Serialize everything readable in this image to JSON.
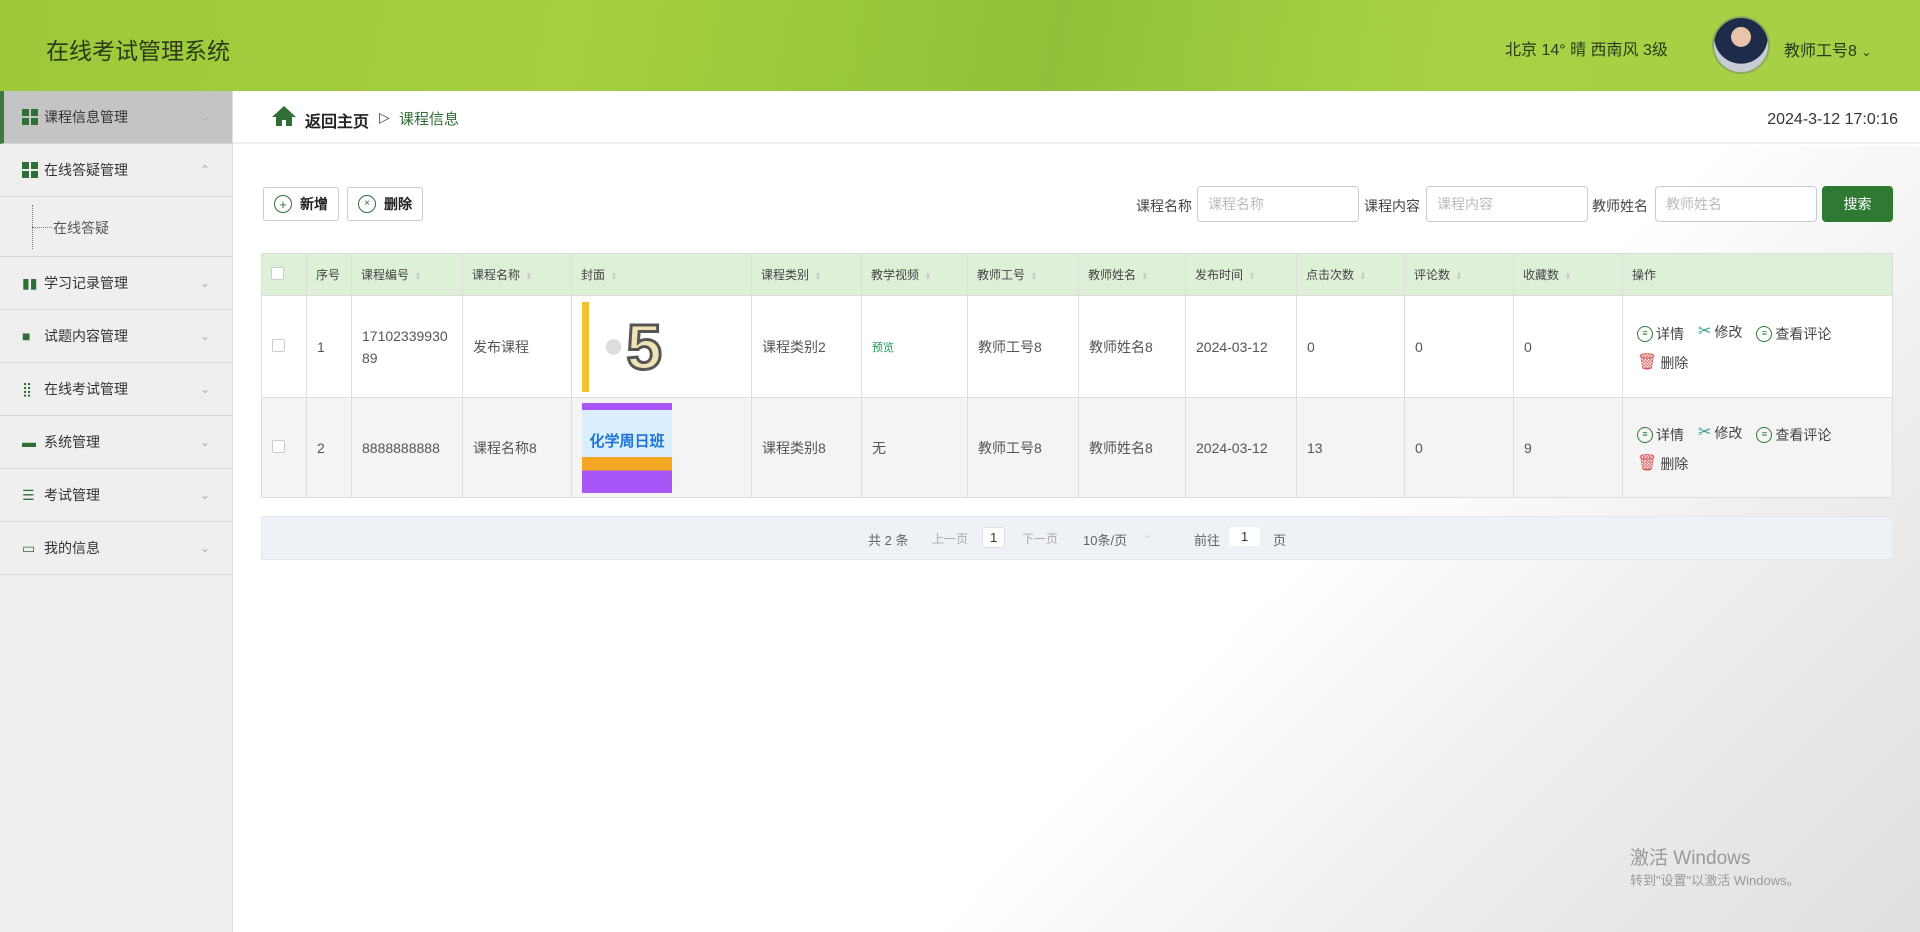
{
  "header": {
    "title": "在线考试管理系统",
    "weather": "北京  14°  晴  西南风  3级",
    "user": "教师工号8",
    "user_caret": "⌄"
  },
  "sidebar": {
    "items": [
      {
        "label": "课程信息管理",
        "chev": "⌄"
      },
      {
        "label": "在线答疑管理",
        "chev": "⌃",
        "sub": [
          "在线答疑"
        ]
      },
      {
        "label": "学习记录管理",
        "chev": "⌄"
      },
      {
        "label": "试题内容管理",
        "chev": "⌄"
      },
      {
        "label": "在线考试管理",
        "chev": "⌄"
      },
      {
        "label": "系统管理",
        "chev": "⌄"
      },
      {
        "label": "考试管理",
        "chev": "⌄"
      },
      {
        "label": "我的信息",
        "chev": "⌄"
      }
    ]
  },
  "breadcrumb": {
    "home": "返回主页",
    "sep": "▷",
    "current": "课程信息",
    "datetime": "2024-3-12 17:0:16"
  },
  "toolbar": {
    "add": "新增",
    "delete": "删除"
  },
  "search": {
    "fields": [
      {
        "label": "课程名称",
        "placeholder": "课程名称"
      },
      {
        "label": "课程内容",
        "placeholder": "课程内容"
      },
      {
        "label": "教师姓名",
        "placeholder": "教师姓名"
      }
    ],
    "button": "搜索"
  },
  "table": {
    "headers": [
      "序号",
      "课程编号",
      "课程名称",
      "封面",
      "课程类别",
      "教学视频",
      "教师工号",
      "教师姓名",
      "发布时间",
      "点击次数",
      "评论数",
      "收藏数",
      "操作"
    ],
    "rows": [
      {
        "index": "1",
        "code": "1710233993089",
        "name": "发布课程",
        "cover_text": "5",
        "category": "课程类别2",
        "video": "预览",
        "teacher_id": "教师工号8",
        "teacher_name": "教师姓名8",
        "date": "2024-03-12",
        "clicks": "0",
        "comments": "0",
        "favorites": "0"
      },
      {
        "index": "2",
        "code": "8888888888",
        "name": "课程名称8",
        "cover_text": "化学周日班",
        "category": "课程类别8",
        "video": "无",
        "teacher_id": "教师工号8",
        "teacher_name": "教师姓名8",
        "date": "2024-03-12",
        "clicks": "13",
        "comments": "0",
        "favorites": "9"
      }
    ],
    "actions": {
      "detail": "详情",
      "edit": "修改",
      "comments": "查看评论",
      "delete": "删除"
    }
  },
  "pagination": {
    "total": "共 2 条",
    "prev": "上一页",
    "page": "1",
    "next": "下一页",
    "size": "10条/页",
    "goto": "前往",
    "goto_value": "1",
    "page_unit": "页"
  },
  "watermark": {
    "line1": "激活 Windows",
    "line2": "转到\"设置\"以激活 Windows。"
  }
}
